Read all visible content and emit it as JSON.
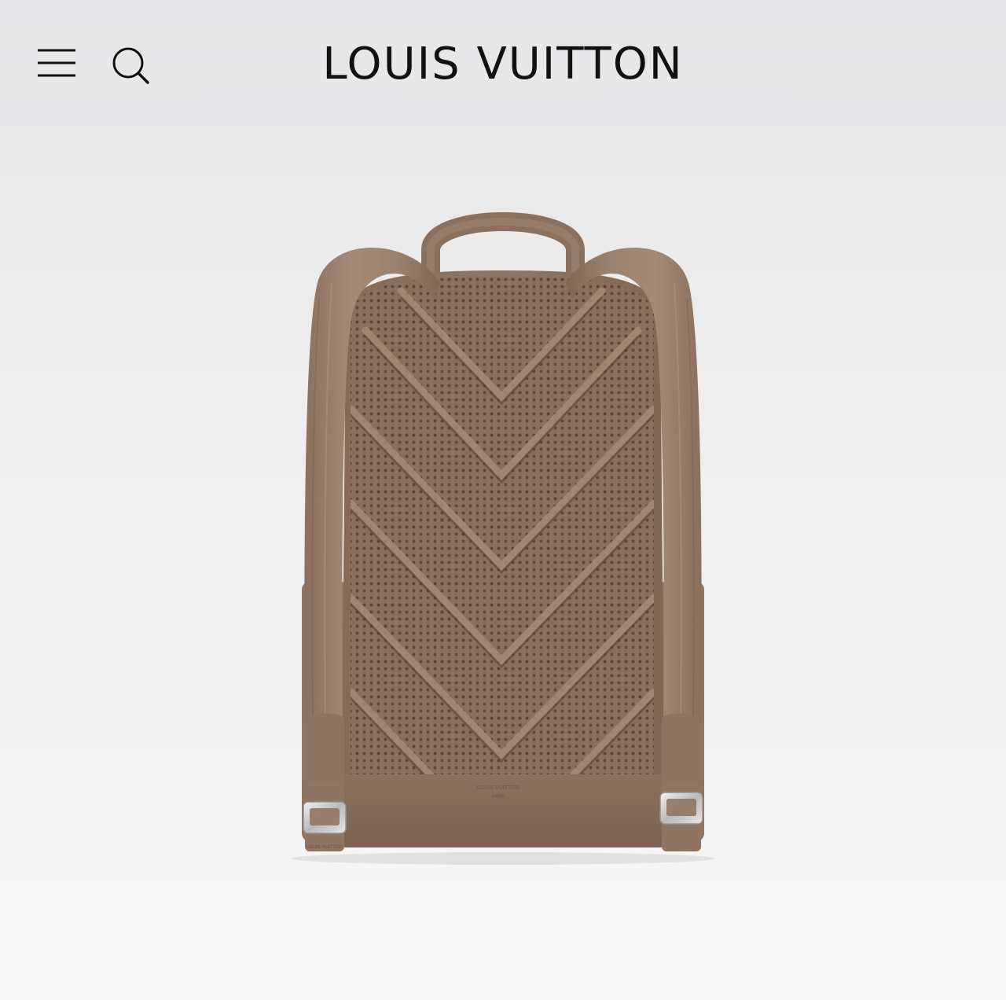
{
  "header": {
    "brand": "LOUIS VUITTON",
    "menu_icon": "hamburger-menu-icon",
    "search_icon": "search-icon"
  },
  "product": {
    "imprint_line1": "LOUIS VUITTON",
    "imprint_line2": "PARIS",
    "strap_imprint": "LOUIS VUITTON"
  },
  "colors": {
    "background": "#ececec",
    "strap": "#9e8571",
    "leather": "#8f7462",
    "mesh": "#7d6454"
  }
}
